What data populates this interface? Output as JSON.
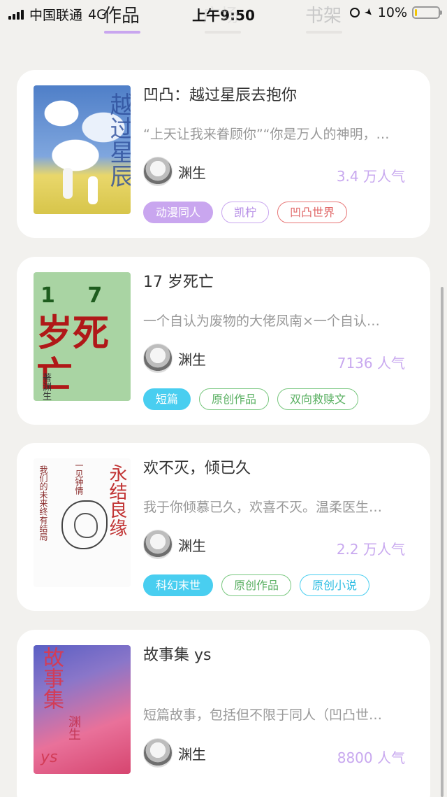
{
  "status_bar": {
    "carrier": "中国联通",
    "network": "4G",
    "time": "上午9:50",
    "battery": "10%",
    "battery_level": 0.1
  },
  "tabs": [
    {
      "label": "作品",
      "active": true
    },
    {
      "label": "广场",
      "active": false
    },
    {
      "label": "书架",
      "active": false
    }
  ],
  "works": [
    {
      "title": "凹凸：越过星辰去抱你",
      "summary": "“上天让我来眷顾你”“你是万人的神明，…",
      "author": "渊生",
      "popularity": "3.4 万人气",
      "cover_text": "越过星辰",
      "tags": [
        {
          "label": "动漫同人",
          "style": "purple"
        },
        {
          "label": "凯柠",
          "style": "purple-outline"
        },
        {
          "label": "凹凸世界",
          "style": "red-outline"
        }
      ]
    },
    {
      "title": "17 岁死亡",
      "summary": "一个自认为废物的大佬凤南×一个自认…",
      "author": "渊生",
      "popularity": "7136 人气",
      "cover_text": {
        "number": "1 7",
        "big": "岁死亡",
        "sig": "著渊生"
      },
      "tags": [
        {
          "label": "短篇",
          "style": "cyan"
        },
        {
          "label": "原创作品",
          "style": "green-outline"
        },
        {
          "label": "双向救赎文",
          "style": "green-outline"
        }
      ]
    },
    {
      "title": "欢不灭，倾已久",
      "summary": "我于你倾慕已久，欢喜不灭。温柔医生…",
      "author": "渊生",
      "popularity": "2.2 万人气",
      "cover_text": {
        "red": "永结良缘",
        "mid": "一见钟情",
        "left": "我们的未来终有结局"
      },
      "tags": [
        {
          "label": "科幻末世",
          "style": "cyan"
        },
        {
          "label": "原创作品",
          "style": "green-outline"
        },
        {
          "label": "原创小说",
          "style": "cyan-outline"
        }
      ]
    },
    {
      "title": "故事集 ys",
      "summary": "短篇故事，包括但不限于同人（凹凸世…",
      "author": "渊生",
      "popularity": "8800 人气",
      "cover_text": {
        "main": "故事集",
        "sig": "渊生",
        "ys": "ys"
      },
      "tags": []
    }
  ]
}
